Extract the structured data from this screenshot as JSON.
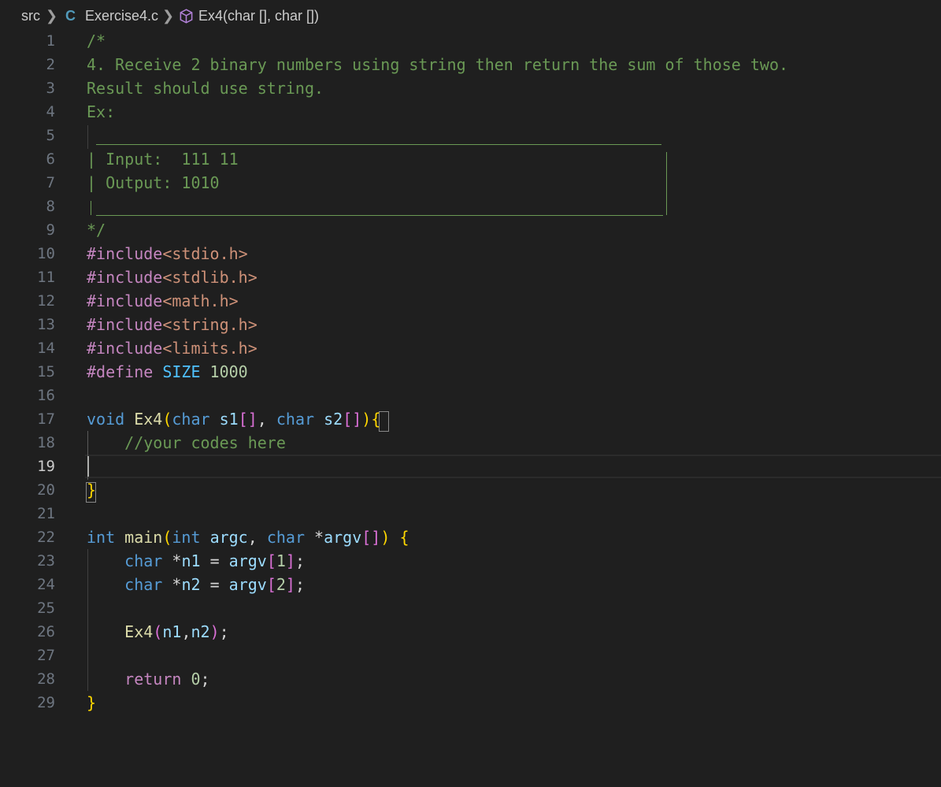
{
  "breadcrumb": {
    "folder": "src",
    "file_icon": "C",
    "file": "Exercise4.c",
    "symbol_icon": "cube-icon",
    "symbol": "Ex4(char [], char [])"
  },
  "editor": {
    "cursor_line": 19,
    "colors": {
      "background": "#1f1f1f",
      "comment": "#6a9955",
      "preprocessor": "#c586c0",
      "string": "#ce9178",
      "keyword": "#569cd6",
      "function": "#dcdcaa",
      "variable": "#9cdcfe",
      "number": "#b5cea8",
      "bracket_1": "#ffd700",
      "bracket_2": "#da70d6",
      "bracket_3": "#179fff"
    },
    "lines": [
      {
        "n": "1",
        "tokens": [
          {
            "t": "/*",
            "c": "cm"
          }
        ]
      },
      {
        "n": "2",
        "tokens": [
          {
            "t": "4. Receive 2 binary numbers using string then return the sum of those two.",
            "c": "cm"
          }
        ]
      },
      {
        "n": "3",
        "tokens": [
          {
            "t": "Result should use string.",
            "c": "cm"
          }
        ]
      },
      {
        "n": "4",
        "tokens": [
          {
            "t": "Ex:",
            "c": "cm"
          }
        ]
      },
      {
        "n": "5",
        "tokens": []
      },
      {
        "n": "6",
        "tokens": [
          {
            "t": "| Input:  111 11",
            "c": "cm"
          }
        ]
      },
      {
        "n": "7",
        "tokens": [
          {
            "t": "| Output: 1010",
            "c": "cm"
          }
        ]
      },
      {
        "n": "8",
        "tokens": []
      },
      {
        "n": "9",
        "tokens": [
          {
            "t": "*/",
            "c": "cm"
          }
        ]
      },
      {
        "n": "10",
        "tokens": [
          {
            "t": "#include",
            "c": "pp"
          },
          {
            "t": "<stdio.h>",
            "c": "str"
          }
        ]
      },
      {
        "n": "11",
        "tokens": [
          {
            "t": "#include",
            "c": "pp"
          },
          {
            "t": "<stdlib.h>",
            "c": "str"
          }
        ]
      },
      {
        "n": "12",
        "tokens": [
          {
            "t": "#include",
            "c": "pp"
          },
          {
            "t": "<math.h>",
            "c": "str"
          }
        ]
      },
      {
        "n": "13",
        "tokens": [
          {
            "t": "#include",
            "c": "pp"
          },
          {
            "t": "<string.h>",
            "c": "str"
          }
        ]
      },
      {
        "n": "14",
        "tokens": [
          {
            "t": "#include",
            "c": "pp"
          },
          {
            "t": "<limits.h>",
            "c": "str"
          }
        ]
      },
      {
        "n": "15",
        "tokens": [
          {
            "t": "#define ",
            "c": "pp"
          },
          {
            "t": "SIZE",
            "c": "const"
          },
          {
            "t": " ",
            "c": "op"
          },
          {
            "t": "1000",
            "c": "num"
          }
        ]
      },
      {
        "n": "16",
        "tokens": []
      },
      {
        "n": "17",
        "tokens": [
          {
            "t": "void",
            "c": "kw"
          },
          {
            "t": " ",
            "c": "op"
          },
          {
            "t": "Ex4",
            "c": "fn"
          },
          {
            "t": "(",
            "c": "b1"
          },
          {
            "t": "char",
            "c": "kw"
          },
          {
            "t": " ",
            "c": "op"
          },
          {
            "t": "s1",
            "c": "var"
          },
          {
            "t": "[]",
            "c": "b2"
          },
          {
            "t": ", ",
            "c": "op"
          },
          {
            "t": "char",
            "c": "kw"
          },
          {
            "t": " ",
            "c": "op"
          },
          {
            "t": "s2",
            "c": "var"
          },
          {
            "t": "[]",
            "c": "b2"
          },
          {
            "t": ")",
            "c": "b1"
          },
          {
            "t": "{",
            "c": "b1"
          }
        ]
      },
      {
        "n": "18",
        "tokens": [
          {
            "t": "    ",
            "c": "op"
          },
          {
            "t": "//your codes here",
            "c": "cm"
          }
        ]
      },
      {
        "n": "19",
        "tokens": []
      },
      {
        "n": "20",
        "tokens": [
          {
            "t": "}",
            "c": "b1"
          }
        ]
      },
      {
        "n": "21",
        "tokens": []
      },
      {
        "n": "22",
        "tokens": [
          {
            "t": "int",
            "c": "kw"
          },
          {
            "t": " ",
            "c": "op"
          },
          {
            "t": "main",
            "c": "fn"
          },
          {
            "t": "(",
            "c": "b1"
          },
          {
            "t": "int",
            "c": "kw"
          },
          {
            "t": " ",
            "c": "op"
          },
          {
            "t": "argc",
            "c": "var"
          },
          {
            "t": ", ",
            "c": "op"
          },
          {
            "t": "char",
            "c": "kw"
          },
          {
            "t": " *",
            "c": "op"
          },
          {
            "t": "argv",
            "c": "var"
          },
          {
            "t": "[]",
            "c": "b2"
          },
          {
            "t": ")",
            "c": "b1"
          },
          {
            "t": " ",
            "c": "op"
          },
          {
            "t": "{",
            "c": "b1"
          }
        ]
      },
      {
        "n": "23",
        "tokens": [
          {
            "t": "    ",
            "c": "op"
          },
          {
            "t": "char",
            "c": "kw"
          },
          {
            "t": " *",
            "c": "op"
          },
          {
            "t": "n1",
            "c": "var"
          },
          {
            "t": " = ",
            "c": "op"
          },
          {
            "t": "argv",
            "c": "var"
          },
          {
            "t": "[",
            "c": "b2"
          },
          {
            "t": "1",
            "c": "num"
          },
          {
            "t": "]",
            "c": "b2"
          },
          {
            "t": ";",
            "c": "op"
          }
        ]
      },
      {
        "n": "24",
        "tokens": [
          {
            "t": "    ",
            "c": "op"
          },
          {
            "t": "char",
            "c": "kw"
          },
          {
            "t": " *",
            "c": "op"
          },
          {
            "t": "n2",
            "c": "var"
          },
          {
            "t": " = ",
            "c": "op"
          },
          {
            "t": "argv",
            "c": "var"
          },
          {
            "t": "[",
            "c": "b2"
          },
          {
            "t": "2",
            "c": "num"
          },
          {
            "t": "]",
            "c": "b2"
          },
          {
            "t": ";",
            "c": "op"
          }
        ]
      },
      {
        "n": "25",
        "tokens": []
      },
      {
        "n": "26",
        "tokens": [
          {
            "t": "    ",
            "c": "op"
          },
          {
            "t": "Ex4",
            "c": "fn"
          },
          {
            "t": "(",
            "c": "b2"
          },
          {
            "t": "n1",
            "c": "var"
          },
          {
            "t": ",",
            "c": "op"
          },
          {
            "t": "n2",
            "c": "var"
          },
          {
            "t": ")",
            "c": "b2"
          },
          {
            "t": ";",
            "c": "op"
          }
        ]
      },
      {
        "n": "27",
        "tokens": []
      },
      {
        "n": "28",
        "tokens": [
          {
            "t": "    ",
            "c": "op"
          },
          {
            "t": "return",
            "c": "pp"
          },
          {
            "t": " ",
            "c": "op"
          },
          {
            "t": "0",
            "c": "num"
          },
          {
            "t": ";",
            "c": "op"
          }
        ]
      },
      {
        "n": "29",
        "tokens": [
          {
            "t": "}",
            "c": "b1"
          }
        ]
      }
    ]
  }
}
